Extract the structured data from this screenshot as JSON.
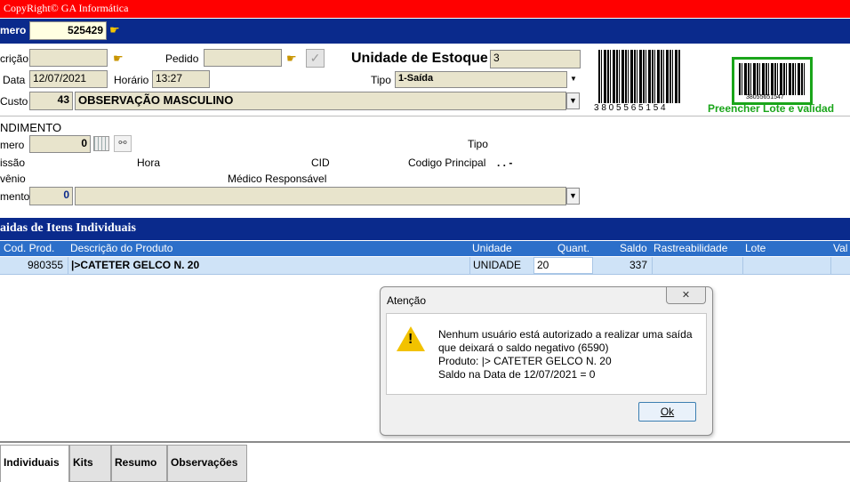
{
  "top_bar": {
    "copyright": "CopyRight© GA Informática",
    "bg": "#ff0000"
  },
  "numero_bar": {
    "label": "mero",
    "value": "525429"
  },
  "form": {
    "descricao_label": "crição",
    "pedido_label": "Pedido",
    "unidade_label": "Unidade de Estoque",
    "unidade_value": "3",
    "data_label": "Data",
    "data_value": "12/07/2021",
    "horario_label": "Horário",
    "horario_value": "13:27",
    "tipo_label": "Tipo",
    "tipo_value": "1-Saída",
    "custo_label": "Custo",
    "custo_code": "43",
    "custo_value": "OBSERVAÇÃO MASCULINO",
    "barcode_number": "3 8 0 5 5 6 5 1 5 4",
    "barcode_small": "38055651547",
    "preencher_text": "Preencher Lote e validad"
  },
  "atendimento": {
    "title": "NDIMENTO",
    "numero_label": "mero",
    "numero_value": "0",
    "tipo_label": "Tipo",
    "admissao_label": "issão",
    "hora_label": "Hora",
    "cid_label": "CID",
    "codigo_label": "Codigo Principal",
    "codigo_value": ". . -",
    "convenio_label": "vênio",
    "medico_label": "Médico Responsável",
    "setor_label": "mento",
    "setor_value": "0"
  },
  "items_section": {
    "title": "aidas de Itens Individuais",
    "headers": [
      "Cod. Prod.",
      "Descrição do Produto",
      "Unidade",
      "Quant.",
      "Saldo",
      "Rastreabilidade",
      "Lote",
      "Val"
    ],
    "row": {
      "cod": "980355",
      "descricao": "|>CATETER GELCO N. 20",
      "unidade": "UNIDADE",
      "quant": "20",
      "saldo": "337"
    }
  },
  "dialog": {
    "title": "Atenção",
    "lines": [
      "Nenhum usuário está autorizado a realizar uma saída",
      "que deixará o saldo negativo (6590)",
      "Produto: |> CATETER GELCO N. 20",
      "Saldo na Data de 12/07/2021 = 0"
    ],
    "ok_label": "Ok",
    "close_label": "✕"
  },
  "tabs": [
    "Individuais",
    "Kits",
    "Resumo",
    "Observações"
  ],
  "colors": {
    "navy": "#0a2a8c",
    "header_blue": "#2c6fc9",
    "selected_row": "#cfe3f7",
    "green": "#1aa51a"
  }
}
